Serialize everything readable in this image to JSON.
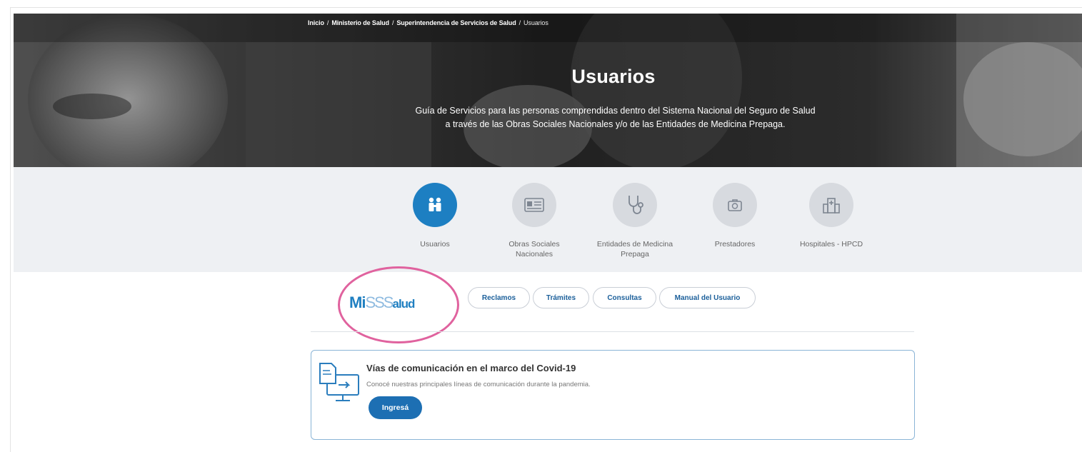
{
  "breadcrumb": {
    "items": [
      "Inicio",
      "Ministerio de Salud",
      "Superintendencia de Servicios de Salud"
    ],
    "current": "Usuarios",
    "separator": "/"
  },
  "hero": {
    "title": "Usuarios",
    "description": "Guía de Servicios para las personas comprendidas dentro del Sistema Nacional del Seguro de Salud a través de las Obras Sociales Nacionales y/o de las Entidades de Medicina Prepaga."
  },
  "categories": [
    {
      "label": "Usuarios",
      "icon": "family-icon",
      "active": true
    },
    {
      "label": "Obras Sociales Nacionales",
      "icon": "id-card-icon",
      "active": false
    },
    {
      "label": "Entidades de Medicina Prepaga",
      "icon": "stethoscope-icon",
      "active": false
    },
    {
      "label": "Prestadores",
      "icon": "medical-kit-icon",
      "active": false
    },
    {
      "label": "Hospitales - HPCD",
      "icon": "hospital-icon",
      "active": false
    }
  ],
  "logo": {
    "mi": "Mi",
    "sss": "SSS",
    "salud": "alud"
  },
  "tabs": {
    "reclamos": "Reclamos",
    "tramites": "Trámites",
    "consultas": "Consultas",
    "manual": "Manual del Usuario"
  },
  "card": {
    "title": "Vías de comunicación en el marco del Covid-19",
    "description": "Conocé nuestras principales líneas de comunicación durante la pandemia.",
    "button": "Ingresá"
  },
  "colors": {
    "accent": "#1d7fc2",
    "button": "#1d6fb3",
    "highlight_ring": "#e0629e",
    "category_bg": "#eef0f3"
  }
}
